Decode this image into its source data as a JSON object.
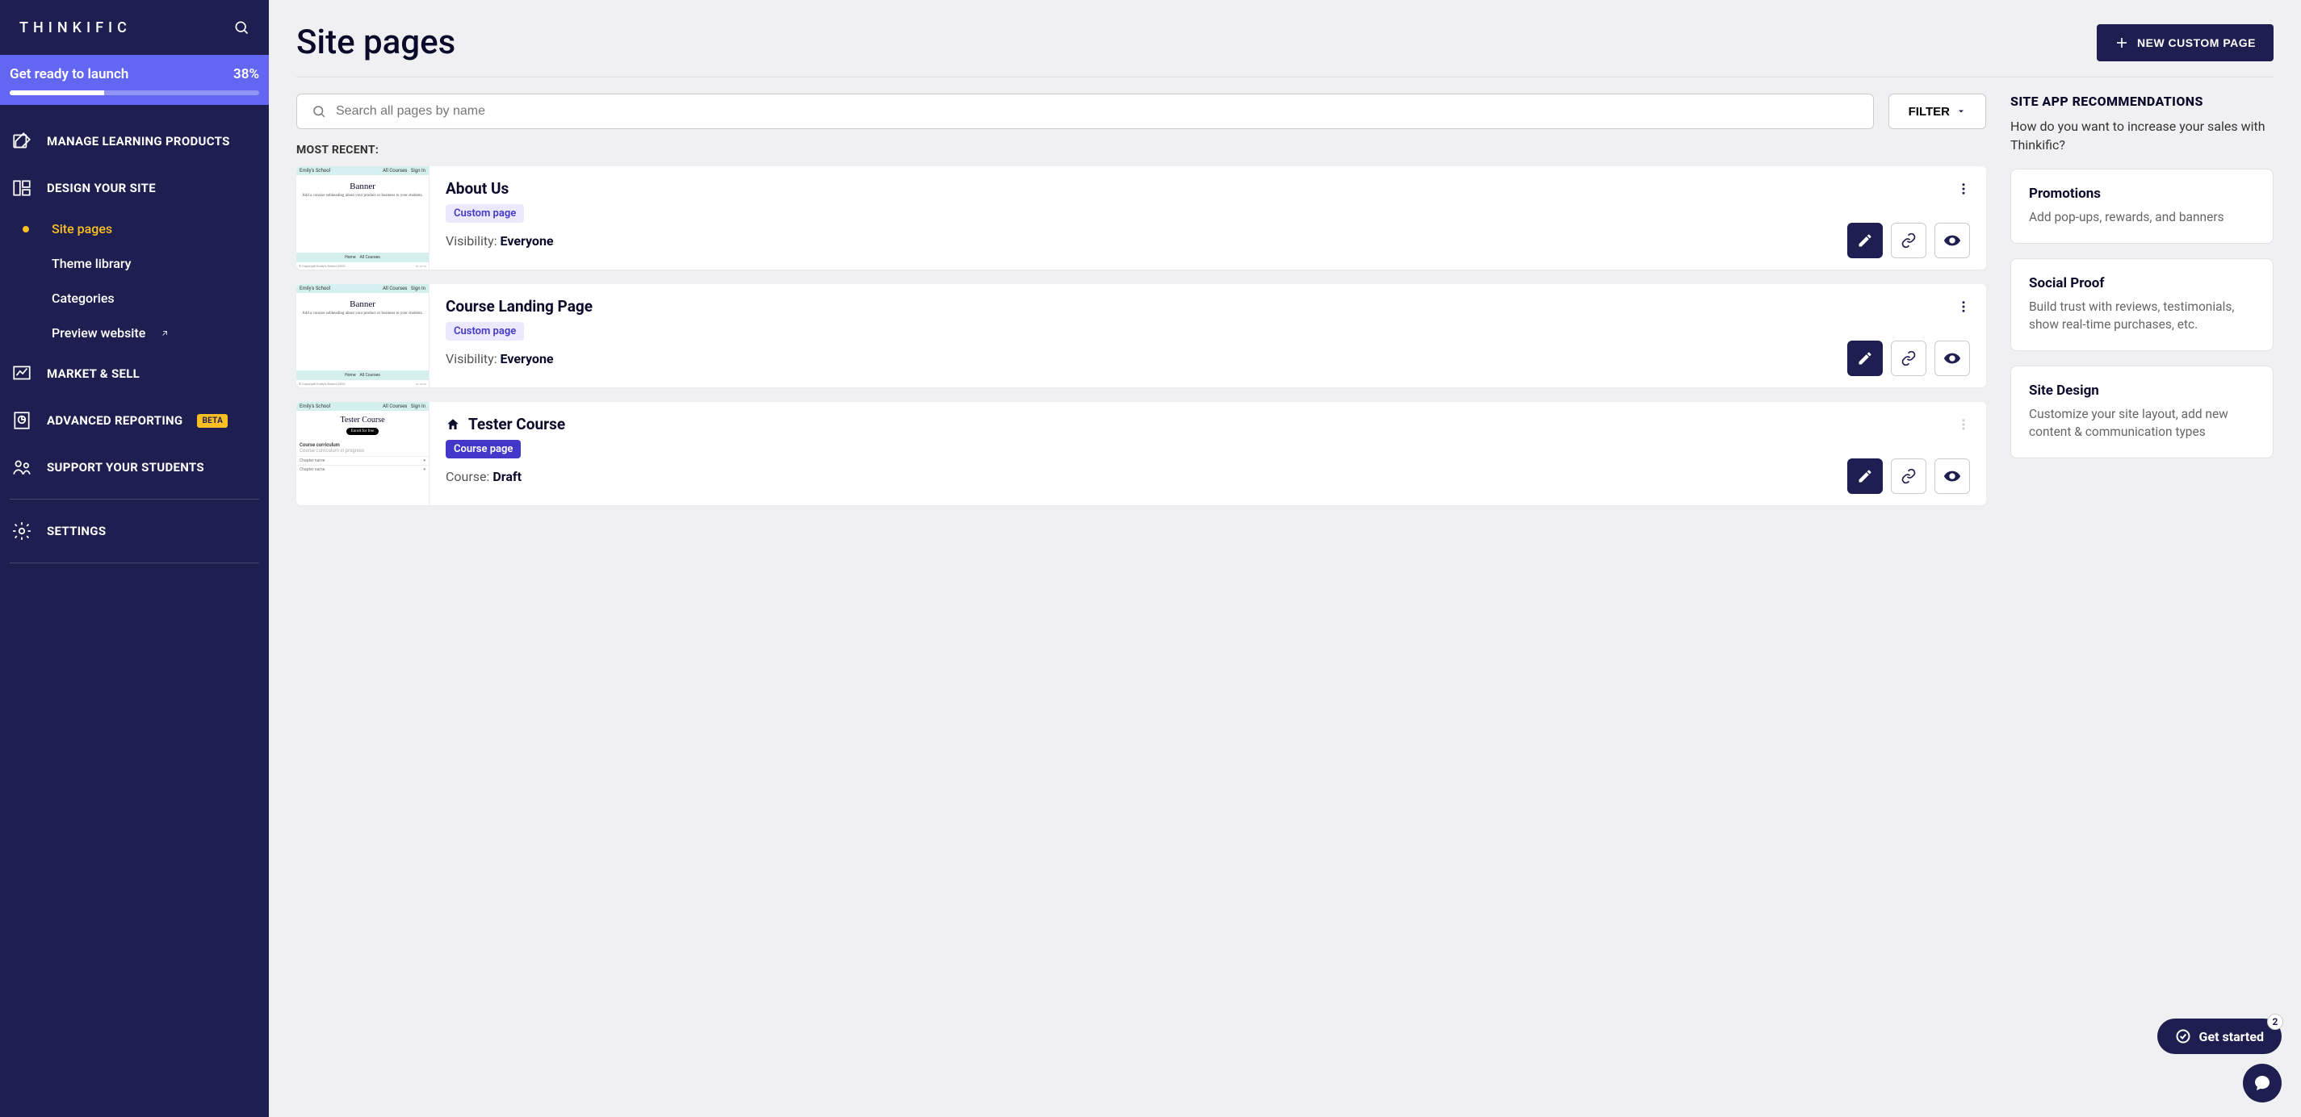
{
  "brand": "THINKIFIC",
  "launch": {
    "label": "Get ready to launch",
    "percent": "38%",
    "value": 38
  },
  "nav": {
    "manage": "MANAGE LEARNING PRODUCTS",
    "design": "DESIGN YOUR SITE",
    "sub": {
      "site_pages": "Site pages",
      "theme_library": "Theme library",
      "categories": "Categories",
      "preview": "Preview website"
    },
    "market": "MARKET & SELL",
    "reporting": "ADVANCED REPORTING",
    "reporting_badge": "BETA",
    "support": "SUPPORT YOUR STUDENTS",
    "settings": "SETTINGS"
  },
  "page": {
    "title": "Site pages",
    "new_button": "NEW CUSTOM PAGE"
  },
  "search": {
    "placeholder": "Search all pages by name"
  },
  "filter_label": "FILTER",
  "most_recent_label": "MOST RECENT:",
  "cards": [
    {
      "title": "About Us",
      "badge": "Custom page",
      "badge_type": "custom",
      "meta_label": "Visibility: ",
      "meta_value": "Everyone",
      "home": false,
      "menu_enabled": true
    },
    {
      "title": "Course Landing Page",
      "badge": "Custom page",
      "badge_type": "custom",
      "meta_label": "Visibility: ",
      "meta_value": "Everyone",
      "home": false,
      "menu_enabled": true
    },
    {
      "title": "Tester Course",
      "badge": "Course page",
      "badge_type": "course",
      "meta_label": "Course: ",
      "meta_value": "Draft",
      "home": true,
      "menu_enabled": false
    }
  ],
  "thumb": {
    "school": "Emily's School",
    "all_courses": "All Courses",
    "sign_in": "Sign In",
    "banner_title": "Banner",
    "banner_sub": "Add a concise subheading about your product or business to your students.",
    "home_label": "Home",
    "copyright": "© Copyright Emily's School 2022",
    "course_title": "Tester Course",
    "enroll": "Enroll for free",
    "curriculum": "Course curriculum",
    "curriculum_sub": "Course curriculum in progress",
    "chapter": "Chapter name"
  },
  "recs": {
    "heading": "SITE APP RECOMMENDATIONS",
    "sub": "How do you want to increase your sales with Thinkific?",
    "items": [
      {
        "title": "Promotions",
        "desc": "Add pop-ups, rewards, and banners"
      },
      {
        "title": "Social Proof",
        "desc": "Build trust with reviews, testimonials, show real-time purchases, etc."
      },
      {
        "title": "Site Design",
        "desc": "Customize your site layout, add new content & communication types"
      }
    ]
  },
  "fab": {
    "label": "Get started",
    "count": "2"
  }
}
